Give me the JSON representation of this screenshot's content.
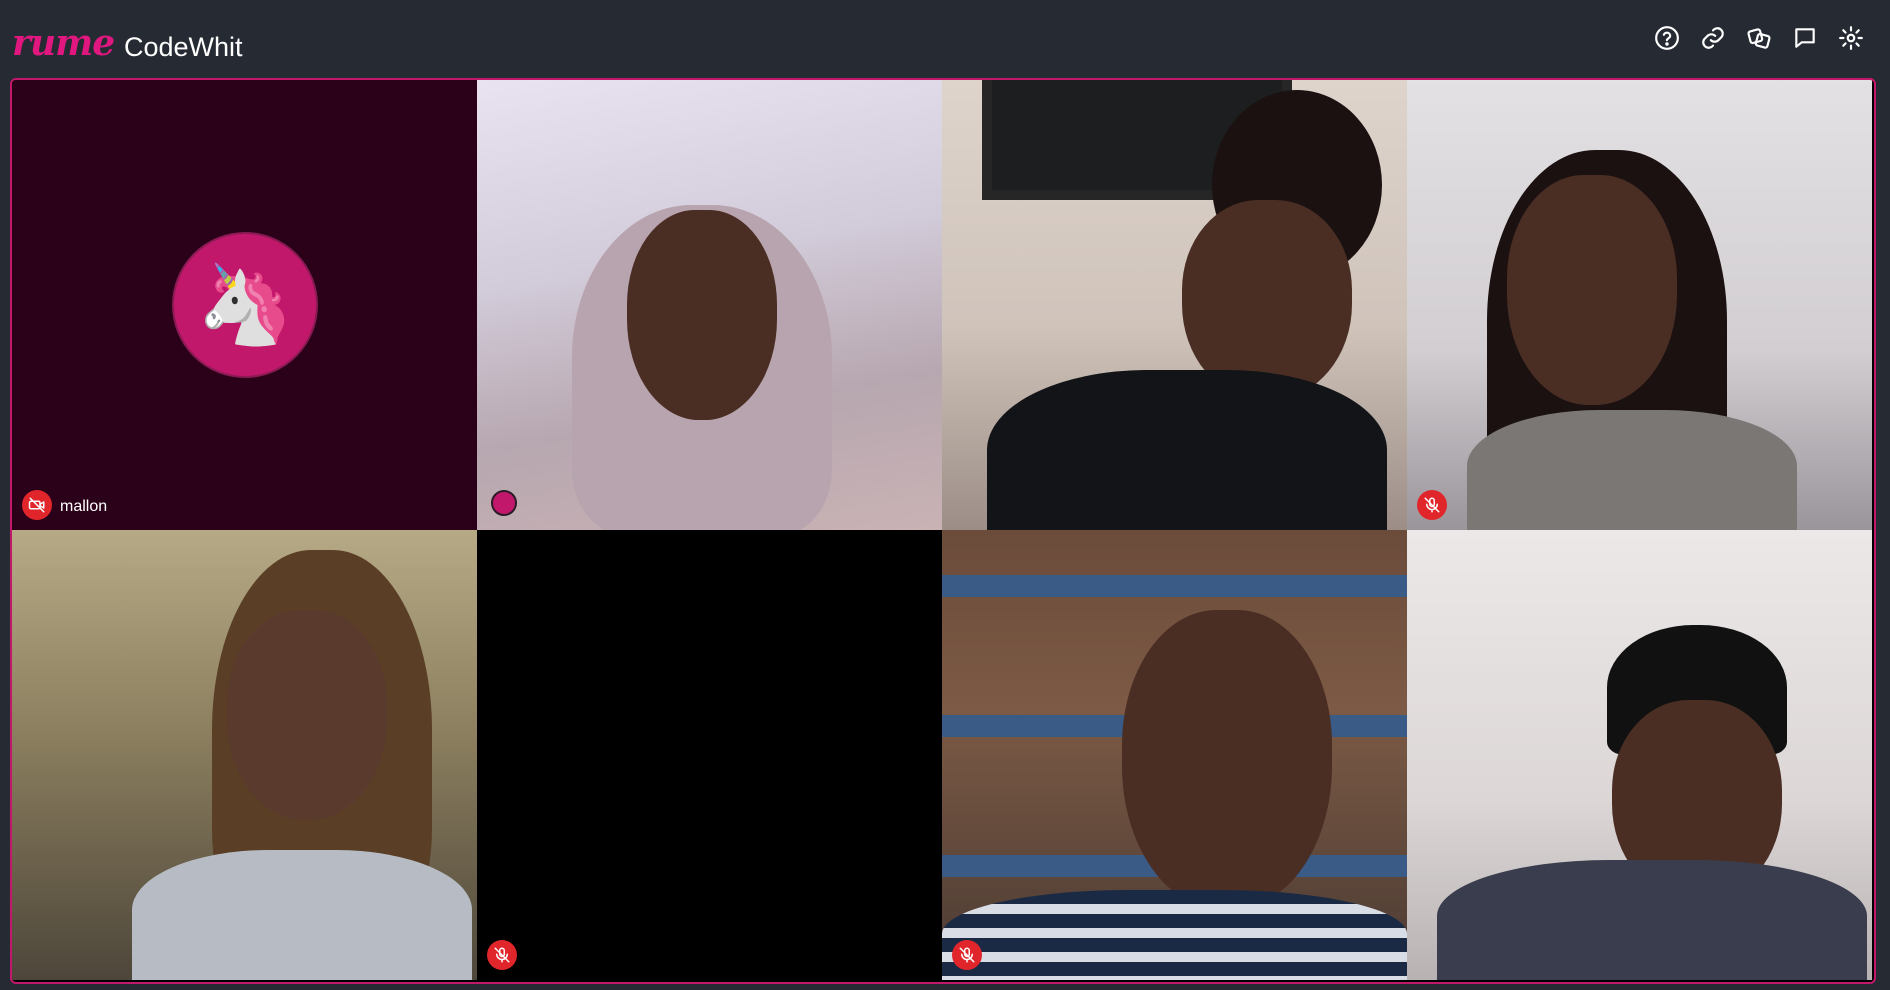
{
  "app": {
    "brand": "rume",
    "room_name": "CodeWhit"
  },
  "toolbar": {
    "icons": [
      "help-icon",
      "link-icon",
      "games-icon",
      "chat-icon",
      "settings-icon"
    ]
  },
  "colors": {
    "accent": "#c2186b",
    "brand": "#e0177f",
    "muted_badge": "#e0262b",
    "topbar_bg": "#262a33",
    "avatar_tile_bg": "#2b0019"
  },
  "participants": [
    {
      "name": "mallon",
      "video": "off",
      "avatar_emoji": "🦄",
      "status": "camera-off"
    },
    {
      "name": "",
      "video": "on",
      "status": "speaking"
    },
    {
      "name": "",
      "video": "on",
      "status": "none"
    },
    {
      "name": "",
      "video": "on",
      "status": "muted"
    },
    {
      "name": "",
      "video": "on",
      "status": "none"
    },
    {
      "name": "",
      "video": "blank",
      "status": "muted"
    },
    {
      "name": "",
      "video": "on",
      "status": "muted"
    },
    {
      "name": "",
      "video": "on",
      "status": "none"
    }
  ]
}
